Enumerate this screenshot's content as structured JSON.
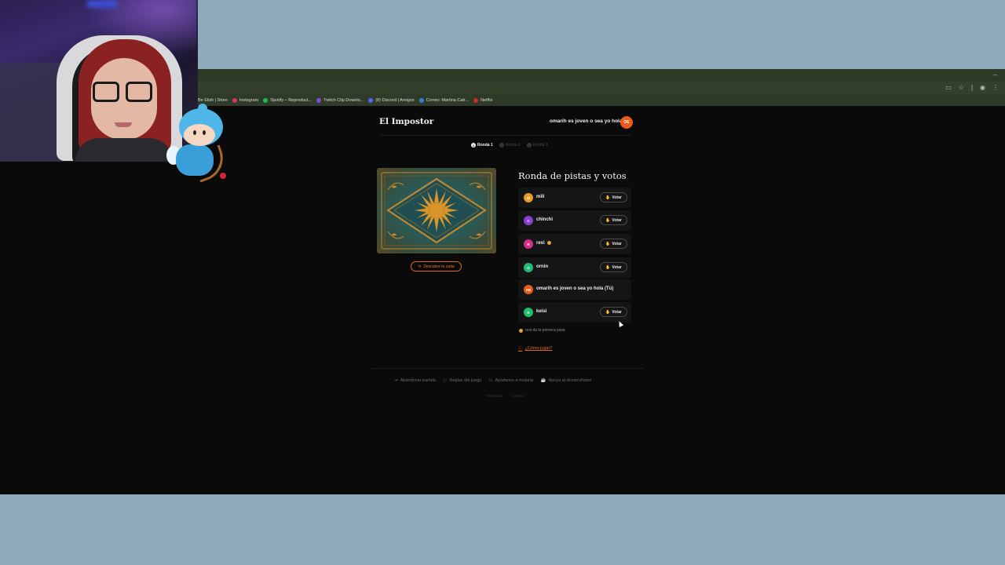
{
  "browser": {
    "bookmarks": [
      {
        "label": "Be Elish | Store",
        "color": "#2f3b29"
      },
      {
        "label": "Instagram",
        "color": "#d6336c"
      },
      {
        "label": "Spotify – Reproduct...",
        "color": "#1db954"
      },
      {
        "label": "Twitch Clip Downlo...",
        "color": "#7b4bd6"
      },
      {
        "label": "(8) Discord | Amigos",
        "color": "#5865f2"
      },
      {
        "label": "Correo: Martina Cab...",
        "color": "#2f7fd3"
      },
      {
        "label": "Netflix",
        "color": "#d3242d"
      }
    ],
    "window_minimize": "–"
  },
  "app": {
    "title": "El Impostor",
    "user": {
      "name": "omarih es joven o sea yo hola",
      "initials": "OE",
      "color": "#ea5a18"
    },
    "rounds": [
      {
        "label": "Ronda 1",
        "num": "1",
        "active": true
      },
      {
        "label": "Ronda 2",
        "num": "2",
        "active": false
      },
      {
        "label": "Ronda 3",
        "num": "3",
        "active": false
      }
    ],
    "reveal_button": "Descubre tu carta",
    "section_title": "Ronda de pistas y votos",
    "vote_label": "Votar",
    "players": [
      {
        "initials": "M",
        "name": "mili",
        "color": "#e89a2a",
        "can_vote": true,
        "first_clue": false
      },
      {
        "initials": "C",
        "name": "chinchi",
        "color": "#8a3fd6",
        "can_vote": true,
        "first_clue": false
      },
      {
        "initials": "R",
        "name": "rexi",
        "color": "#d62d86",
        "can_vote": true,
        "first_clue": true
      },
      {
        "initials": "O",
        "name": "ornin",
        "color": "#22b87a",
        "can_vote": true,
        "first_clue": false
      },
      {
        "initials": "OE",
        "name": "omarih es joven o sea yo hola (Tú)",
        "color": "#ea5a18",
        "can_vote": false,
        "first_clue": false
      },
      {
        "initials": "K",
        "name": "keisi",
        "color": "#1fbf6a",
        "can_vote": true,
        "first_clue": false
      }
    ],
    "hint": "rexi da la primera pista",
    "how_to_play": "¿Cómo jugar?",
    "footer_links": [
      "Abandonar partida",
      "Reglas del juego",
      "Ayúdanos a mejorar",
      "Apoya al desarrollador"
    ],
    "legal_links": [
      "Privacidad",
      "Cookies"
    ]
  },
  "colors": {
    "accent": "#e06a24",
    "background": "#0a0a0a",
    "outer": "#8eaabb"
  }
}
